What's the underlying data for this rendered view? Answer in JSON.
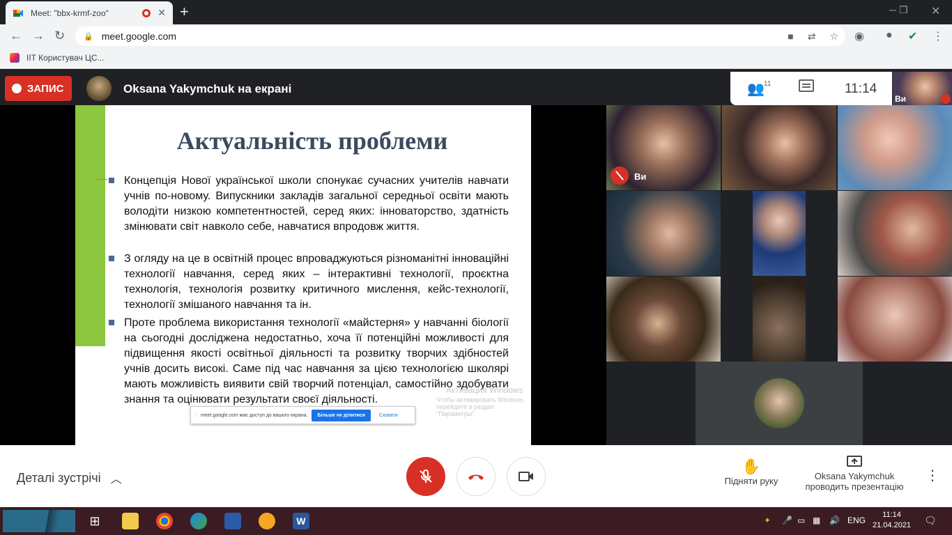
{
  "browser": {
    "tab_title": "Meet: \"bbx-krmf-zoo\"",
    "url": "meet.google.com",
    "bookmark": "IIT Користувач ЦС..."
  },
  "meet": {
    "record_label": "ЗАПИС",
    "presenter_label": "Oksana Yakymchuk на екрані",
    "participants_count": "11",
    "clock": "11:14",
    "self_label": "Ви"
  },
  "slide": {
    "title": "Актуальність проблеми",
    "bullets": [
      "Концепція Нової української школи спонукає сучасних учителів навчати учнів по-новому. Випускники закладів загальної середньої освіти мають володіти низкою компетентностей, серед яких: інноваторство, здатність змінювати світ навколо себе, навчатися впродовж життя.",
      "З огляду на це в освітній процес впроваджуються різноманітні інноваційні технології навчання, серед яких – інтерактивні технології, проєктна технологія, технологія розвитку критичного мислення, кейс-технології, технології змішаного навчання та ін.",
      "Проте проблема використання технології «майстерня» у навчанні біології на сьогодні досліджена недостатньо, хоча її потенційні можливості для підвищення якості освітньої діяльності та розвитку творчих здібностей учнів досить високі. Саме під час навчання за цією технологією школярі мають можливість виявити свій творчий потенціал, самостійно здобувати знання та оцінювати результати своєї діяльності."
    ],
    "watermark_line1": "Активация Windows",
    "watermark_line2": "Чтобы активировать Windows, перейдите в раздел \"Параметры\".",
    "share_text": "meet.google.com має доступ до вашого екрана.",
    "share_stop": "Більше не ділитися",
    "share_hide": "Сховати"
  },
  "tiles": {
    "self_name": "Ви"
  },
  "bottom": {
    "details_label": "Деталі зустрічі",
    "raise_hand_label": "Підняти руку",
    "presenting_line1": "Oksana Yakymchuk",
    "presenting_line2": "проводить презентацію"
  },
  "taskbar": {
    "lang": "ENG",
    "time": "11:14",
    "date": "21.04.2021"
  },
  "colors": {
    "record_red": "#d93025",
    "slide_green": "#8dc63f",
    "share_blue": "#1a73e8"
  }
}
